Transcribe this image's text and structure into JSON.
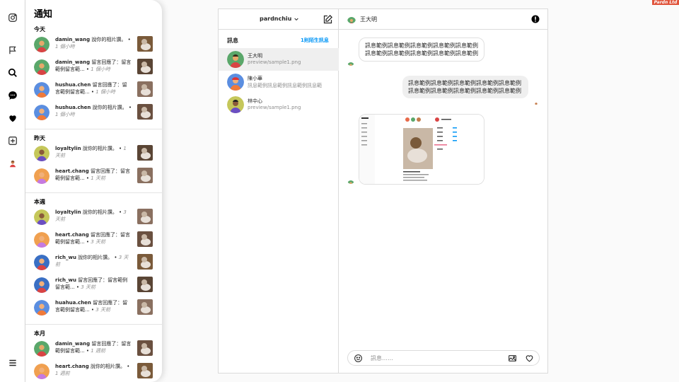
{
  "brand": {
    "label": "Pardn Ltd",
    "color": "#e0533a"
  },
  "rail": {
    "icons": [
      "instagram-icon",
      "flag-icon",
      "search-icon",
      "message-icon",
      "heart-icon",
      "add-post-icon",
      "profile-avatar",
      "menu-icon"
    ]
  },
  "notifications": {
    "title": "通知",
    "sections": [
      {
        "label": "今天",
        "items": [
          {
            "user": "damin_wang",
            "text": "說你的相片讚。",
            "time": "1 個小時"
          },
          {
            "user": "damin_wang",
            "text": "留言回應了：留言範例留言範...",
            "time": "1 個小時"
          },
          {
            "user": "hushua.chen",
            "text": "留言回應了：留言範例留言範...",
            "time": "1 個小時"
          },
          {
            "user": "hushua.chen",
            "text": "說你的相片讚。",
            "time": "1 個小時"
          }
        ]
      },
      {
        "label": "昨天",
        "items": [
          {
            "user": "loyaltylin",
            "text": "說你的相片讚。",
            "time": "1 天前"
          },
          {
            "user": "heart.chang",
            "text": "留言回應了：留言範例留言範...",
            "time": "1 天前"
          }
        ]
      },
      {
        "label": "本週",
        "items": [
          {
            "user": "loyaltylin",
            "text": "說你的相片讚。",
            "time": "3 天前"
          },
          {
            "user": "heart.chang",
            "text": "留言回應了：留言範例留言範...",
            "time": "3 天前"
          },
          {
            "user": "rich_wu",
            "text": "說你的相片讚。",
            "time": "3 天前"
          },
          {
            "user": "rich_wu",
            "text": "留言回應了：留言範例留言範...",
            "time": "3 天前"
          },
          {
            "user": "huahua.chen",
            "text": "留言回應了：留言範例留言範...",
            "time": "3 天前"
          }
        ]
      },
      {
        "label": "本月",
        "items": [
          {
            "user": "damin_wang",
            "text": "留言回應了：留言範例留言範...",
            "time": "1 週前"
          },
          {
            "user": "heart.chang",
            "text": "說你的相片讚。",
            "time": "1 週前"
          }
        ]
      }
    ]
  },
  "messenger": {
    "account": "pardnchiu",
    "conversations_label": "訊息",
    "strangers_link": "1則陌生訊息",
    "conversations": [
      {
        "name": "王大明",
        "preview": "preview/sample1.png"
      },
      {
        "name": "陳小華",
        "preview": "訊息範例訊息範例訊息範例訊息範"
      },
      {
        "name": "林中心",
        "preview": "preview/sample1.png"
      }
    ],
    "chat": {
      "name": "王大明",
      "messages": [
        {
          "dir": "in",
          "text": "訊息範例訊息範例訊息範例訊息範例訊息範例訊息範例訊息範例訊息範例訊息範例訊息範例"
        },
        {
          "dir": "out",
          "text": "訊息範例訊息範例訊息範例訊息範例訊息範例訊息範例訊息範例訊息範例訊息範例訊息範例"
        }
      ],
      "composer_placeholder": "訊息……"
    }
  }
}
